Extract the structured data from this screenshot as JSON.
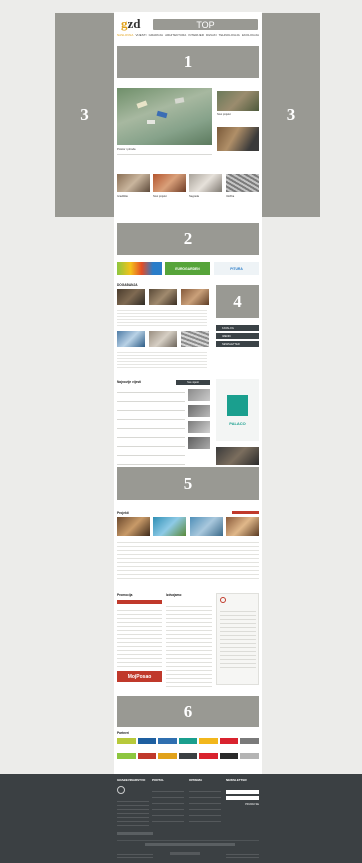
{
  "header": {
    "logo_g": "g",
    "logo_zd": "zd",
    "top_label": "TOP",
    "nav": [
      "NASLOVNA",
      "VIJESTI",
      "GRADNJA",
      "ARHITEKTURA",
      "INTERIJER",
      "DIZAJN",
      "TEHNOLOGIJA",
      "EKOLOGIJA"
    ]
  },
  "ads": {
    "slot1": "1",
    "slot2": "2",
    "slot3_left": "3",
    "slot3_right": "3",
    "slot4": "4",
    "slot5": "5",
    "slot6": "6"
  },
  "lead": {
    "main_caption": "Prostor i priroda",
    "side_caption": "Novi projekt"
  },
  "row_items": [
    "Gradilište",
    "Novi projekt",
    "Nagrada",
    "Izložba"
  ],
  "sponsors": {
    "mid": "EUROGARDEN",
    "right": "PITURA"
  },
  "section_events": {
    "title": "DOGAĐANJA"
  },
  "sidebar_buttons": [
    "KATALOG",
    "IMENIK",
    "NEWSLETTER"
  ],
  "palaco": {
    "label": "PALACO"
  },
  "news_list": {
    "title": "Najnovije vijesti",
    "badge": "Sve vijesti"
  },
  "section_projects": {
    "title": "Projekti"
  },
  "columns": {
    "col1": "Promocija",
    "col2": "Izdvajamo",
    "brand": "MojPosao"
  },
  "partners": {
    "title": "Partneri"
  },
  "footer": {
    "col1": "GRAĐEVINARSTVO",
    "col2": "PORTAL",
    "col3": "OPREMA",
    "col4": "NEWSLETTER",
    "submit": "PRIJAVI SE"
  },
  "colors": {
    "placeholder": "#999993",
    "accent": "#e1a21a",
    "footer": "#3b4043"
  }
}
